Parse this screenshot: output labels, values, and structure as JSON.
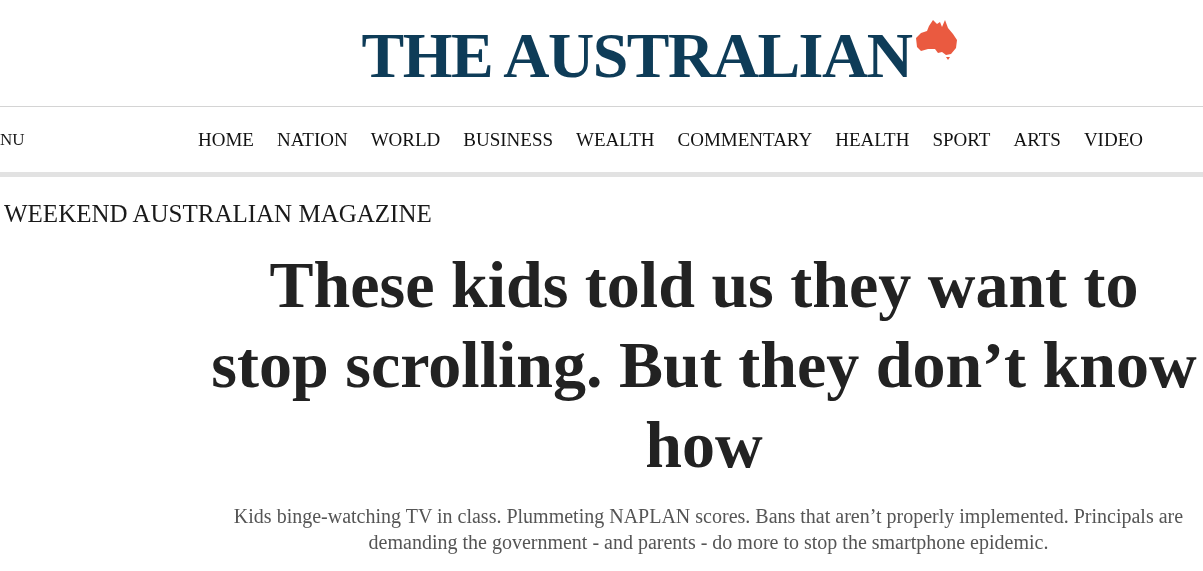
{
  "masthead": {
    "title": "THE AUSTRALIAN"
  },
  "menu": {
    "label": "NU"
  },
  "nav": {
    "items": [
      {
        "label": "HOME"
      },
      {
        "label": "NATION"
      },
      {
        "label": "WORLD"
      },
      {
        "label": "BUSINESS"
      },
      {
        "label": "WEALTH"
      },
      {
        "label": "COMMENTARY"
      },
      {
        "label": "HEALTH"
      },
      {
        "label": "SPORT"
      },
      {
        "label": "ARTS"
      },
      {
        "label": "VIDEO"
      }
    ]
  },
  "article": {
    "section": "WEEKEND AUSTRALIAN MAGAZINE",
    "headline": "These kids told us they want to stop scrolling. But they don’t know how",
    "standfirst": "Kids binge-watching TV in class. Plummeting NAPLAN scores. Bans that aren’t properly implemented. Principals are demanding the government - and parents - do more to stop the smartphone epidemic."
  }
}
